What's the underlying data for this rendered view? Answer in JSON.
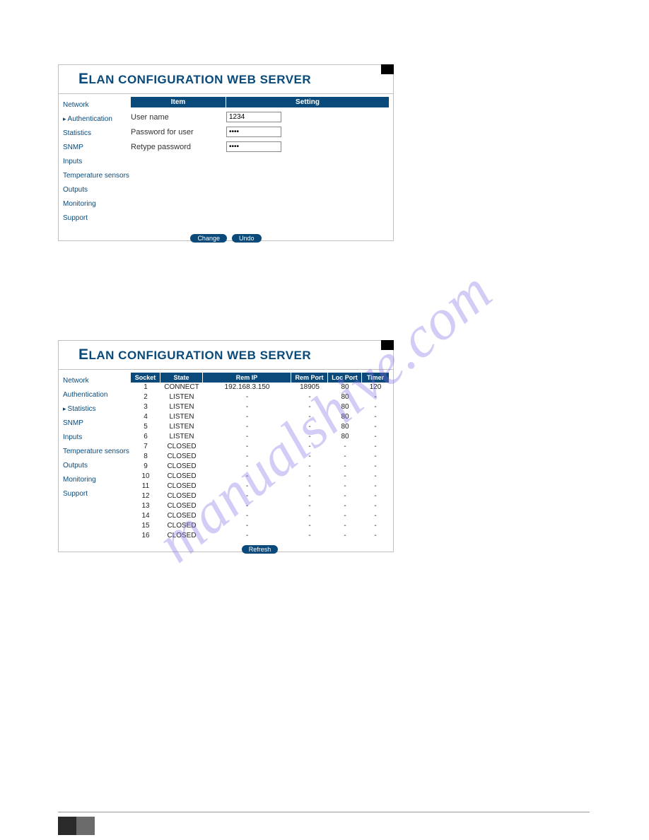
{
  "watermark": "manualshive.com",
  "title_prefix": "E",
  "title_rest": "LAN CONFIGURATION WEB SERVER",
  "nav": {
    "network": "Network",
    "authentication": "Authentication",
    "statistics": "Statistics",
    "snmp": "SNMP",
    "inputs": "Inputs",
    "temperature": "Temperature sensors",
    "outputs": "Outputs",
    "monitoring": "Monitoring",
    "support": "Support"
  },
  "auth": {
    "hdr_item": "Item",
    "hdr_setting": "Setting",
    "rows": {
      "user_label": "User name",
      "user_value": "1234",
      "pass_label": "Password for user",
      "pass_value": "••••",
      "retype_label": "Retype password",
      "retype_value": "••••"
    },
    "btn_change": "Change",
    "btn_undo": "Undo"
  },
  "stats": {
    "hdr": {
      "socket": "Socket",
      "state": "State",
      "remip": "Rem IP",
      "remport": "Rem Port",
      "locport": "Loc Port",
      "timer": "Timer"
    },
    "rows": [
      {
        "socket": "1",
        "state": "CONNECT",
        "remip": "192.168.3.150",
        "remport": "18905",
        "locport": "80",
        "timer": "120"
      },
      {
        "socket": "2",
        "state": "LISTEN",
        "remip": "-",
        "remport": "-",
        "locport": "80",
        "timer": "-"
      },
      {
        "socket": "3",
        "state": "LISTEN",
        "remip": "-",
        "remport": "-",
        "locport": "80",
        "timer": "-"
      },
      {
        "socket": "4",
        "state": "LISTEN",
        "remip": "-",
        "remport": "-",
        "locport": "80",
        "timer": "-"
      },
      {
        "socket": "5",
        "state": "LISTEN",
        "remip": "-",
        "remport": "-",
        "locport": "80",
        "timer": "-"
      },
      {
        "socket": "6",
        "state": "LISTEN",
        "remip": "-",
        "remport": "-",
        "locport": "80",
        "timer": "-"
      },
      {
        "socket": "7",
        "state": "CLOSED",
        "remip": "-",
        "remport": "-",
        "locport": "-",
        "timer": "-"
      },
      {
        "socket": "8",
        "state": "CLOSED",
        "remip": "-",
        "remport": "-",
        "locport": "-",
        "timer": "-"
      },
      {
        "socket": "9",
        "state": "CLOSED",
        "remip": "-",
        "remport": "-",
        "locport": "-",
        "timer": "-"
      },
      {
        "socket": "10",
        "state": "CLOSED",
        "remip": "-",
        "remport": "-",
        "locport": "-",
        "timer": "-"
      },
      {
        "socket": "11",
        "state": "CLOSED",
        "remip": "-",
        "remport": "-",
        "locport": "-",
        "timer": "-"
      },
      {
        "socket": "12",
        "state": "CLOSED",
        "remip": "-",
        "remport": "-",
        "locport": "-",
        "timer": "-"
      },
      {
        "socket": "13",
        "state": "CLOSED",
        "remip": "-",
        "remport": "-",
        "locport": "-",
        "timer": "-"
      },
      {
        "socket": "14",
        "state": "CLOSED",
        "remip": "-",
        "remport": "-",
        "locport": "-",
        "timer": "-"
      },
      {
        "socket": "15",
        "state": "CLOSED",
        "remip": "-",
        "remport": "-",
        "locport": "-",
        "timer": "-"
      },
      {
        "socket": "16",
        "state": "CLOSED",
        "remip": "-",
        "remport": "-",
        "locport": "-",
        "timer": "-"
      }
    ],
    "btn_refresh": "Refresh"
  }
}
